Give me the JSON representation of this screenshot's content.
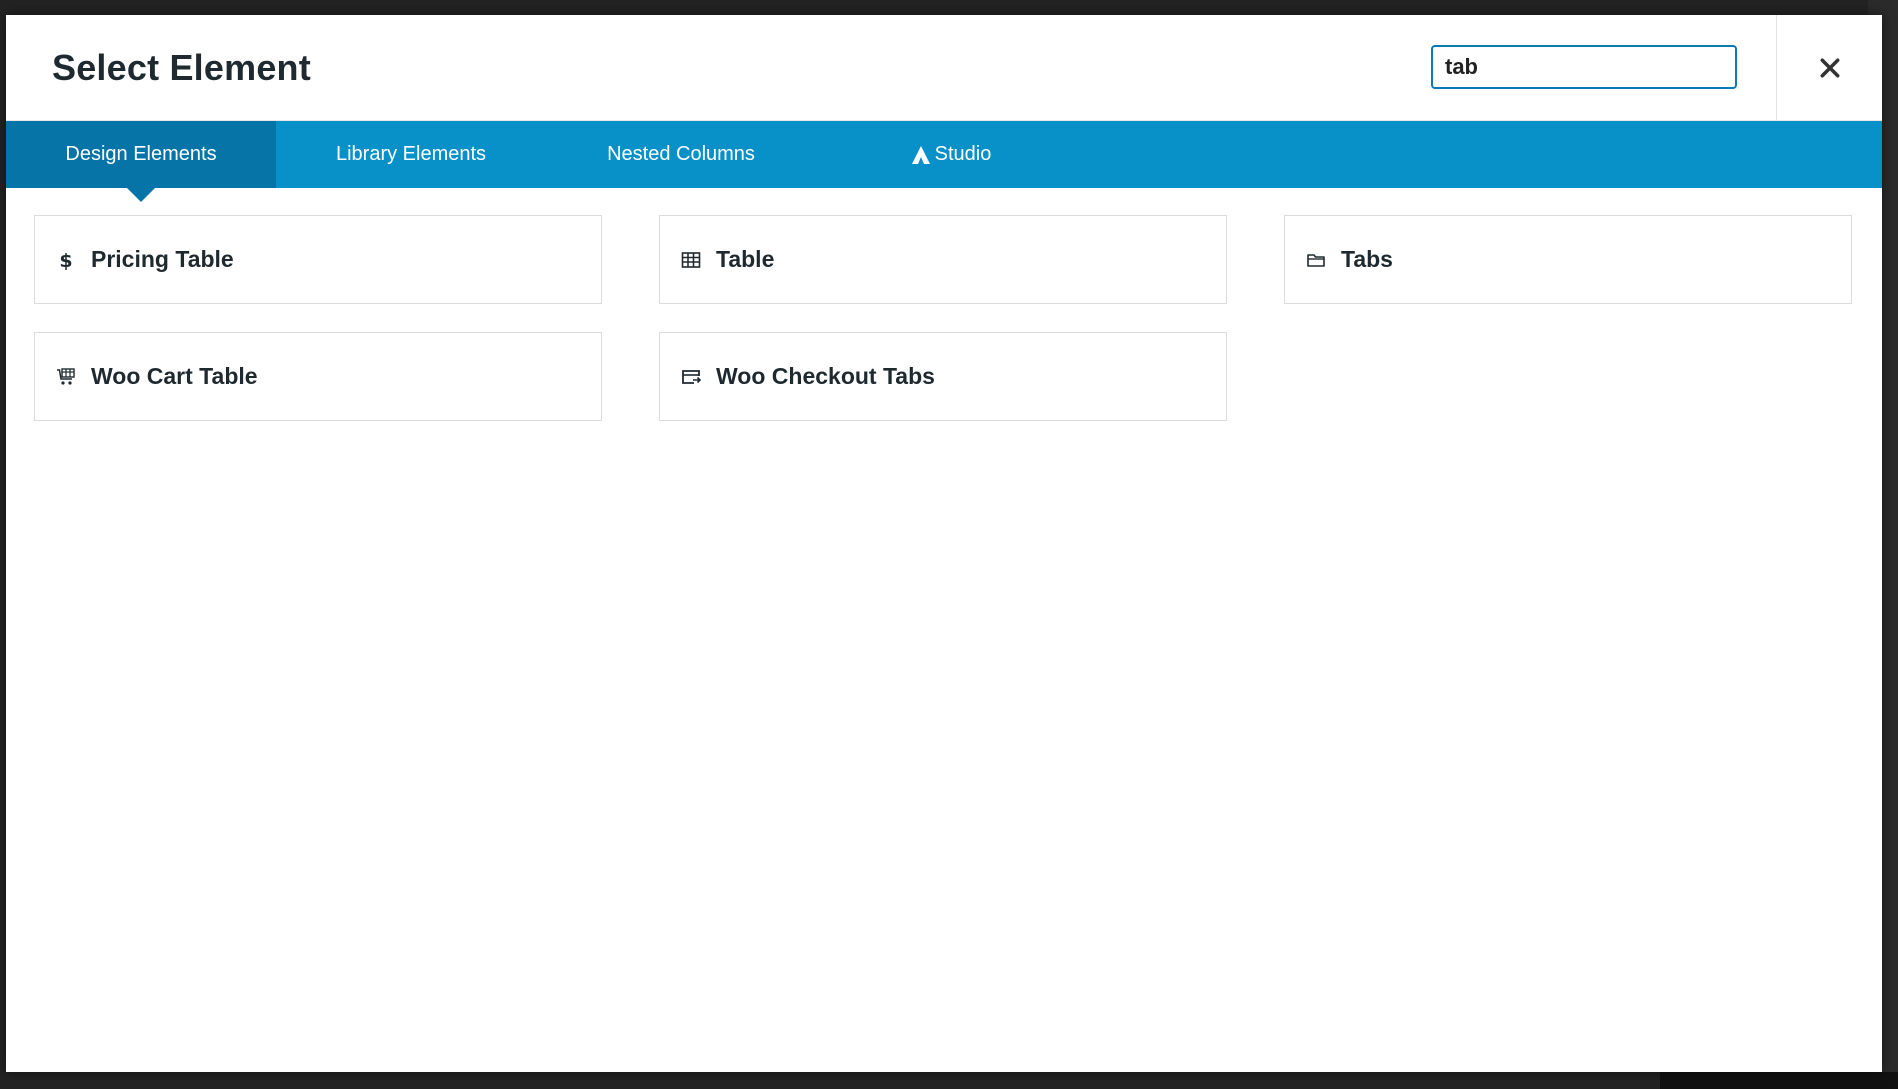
{
  "modal": {
    "title": "Select Element",
    "search_value": "tab",
    "close_icon": "close-icon"
  },
  "tabs": [
    {
      "label": "Design Elements",
      "active": true
    },
    {
      "label": "Library Elements",
      "active": false
    },
    {
      "label": "Nested Columns",
      "active": false
    },
    {
      "label": "Studio",
      "active": false,
      "icon": "studio-logo-icon"
    }
  ],
  "elements": [
    {
      "label": "Pricing Table",
      "icon": "dollar-icon"
    },
    {
      "label": "Table",
      "icon": "table-icon"
    },
    {
      "label": "Tabs",
      "icon": "folder-icon"
    },
    {
      "label": "Woo Cart Table",
      "icon": "cart-table-icon"
    },
    {
      "label": "Woo Checkout Tabs",
      "icon": "checkout-tabs-icon"
    }
  ],
  "colors": {
    "tab_bar": "#0891c8",
    "tab_active": "#0674a6",
    "search_border": "#0a7ab8"
  }
}
